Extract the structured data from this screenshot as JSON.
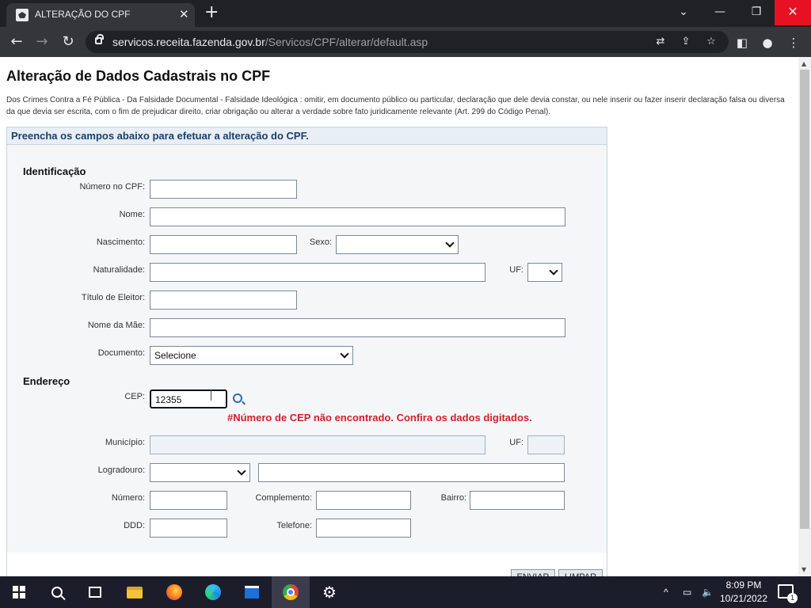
{
  "browser": {
    "tab_title": "ALTERAÇÃO DO CPF",
    "tab_close": "✕",
    "new_tab": "+",
    "url_host": "servicos.receita.fazenda.gov.br",
    "url_path": "/Servicos/CPF/alterar/default.asp",
    "icons": [
      "back-arrow-icon",
      "forward-arrow-icon",
      "reload-icon",
      "lock-icon",
      "translate-icon",
      "share-icon",
      "star-icon",
      "side-panel-icon",
      "profile-icon",
      "more-menu-icon"
    ]
  },
  "page": {
    "title": "Alteração de Dados Cadastrais no CPF",
    "warning": "Dos Crimes Contra a Fé Pública - Da Falsidade Documental - Falsidade Ideológica : omitir, em documento público ou particular, declaração que dele devia constar, ou nele inserir ou fazer inserir declaração falsa ou diversa da que devia ser escrita, com o fim de prejudicar direito, criar obrigação ou alterar a verdade sobre fato juridicamente relevante (Art. 299 do Código Penal).",
    "form_header": "Preencha os campos abaixo para efetuar a alteração do CPF."
  },
  "identificacao": {
    "section_title": "Identificação",
    "cpf_label": "Número no CPF:",
    "cpf_value": "",
    "nome_label": "Nome:",
    "nome_value": "",
    "nascimento_label": "Nascimento:",
    "nascimento_value": "",
    "sexo_label": "Sexo:",
    "sexo_value": "",
    "naturalidade_label": "Naturalidade:",
    "naturalidade_value": "",
    "uf_label": "UF:",
    "uf_value": "",
    "titulo_label": "Título de Eleitor:",
    "titulo_value": "",
    "mae_label": "Nome da Mãe:",
    "mae_value": "",
    "documento_label": "Documento:",
    "documento_value": "Selecione"
  },
  "endereco": {
    "section_title": "Endereço",
    "cep_label": "CEP:",
    "cep_value": "12355",
    "cep_error": "#Número de CEP não encontrado. Confira os dados digitados.",
    "municipio_label": "Município:",
    "municipio_value": "",
    "uf_label": "UF:",
    "uf_value": "",
    "logradouro_label": "Logradouro:",
    "logradouro_type": "",
    "logradouro_value": "",
    "numero_label": "Número:",
    "numero_value": "",
    "complemento_label": "Complemento:",
    "complemento_value": "",
    "bairro_label": "Bairro:",
    "bairro_value": "",
    "ddd_label": "DDD:",
    "ddd_value": "",
    "telefone_label": "Telefone:",
    "telefone_value": ""
  },
  "buttons": {
    "enviar": "ENVIAR",
    "limpar": "LIMPAR"
  },
  "taskbar": {
    "time": "8:09 PM",
    "date": "10/21/2022",
    "notification_count": "1"
  }
}
